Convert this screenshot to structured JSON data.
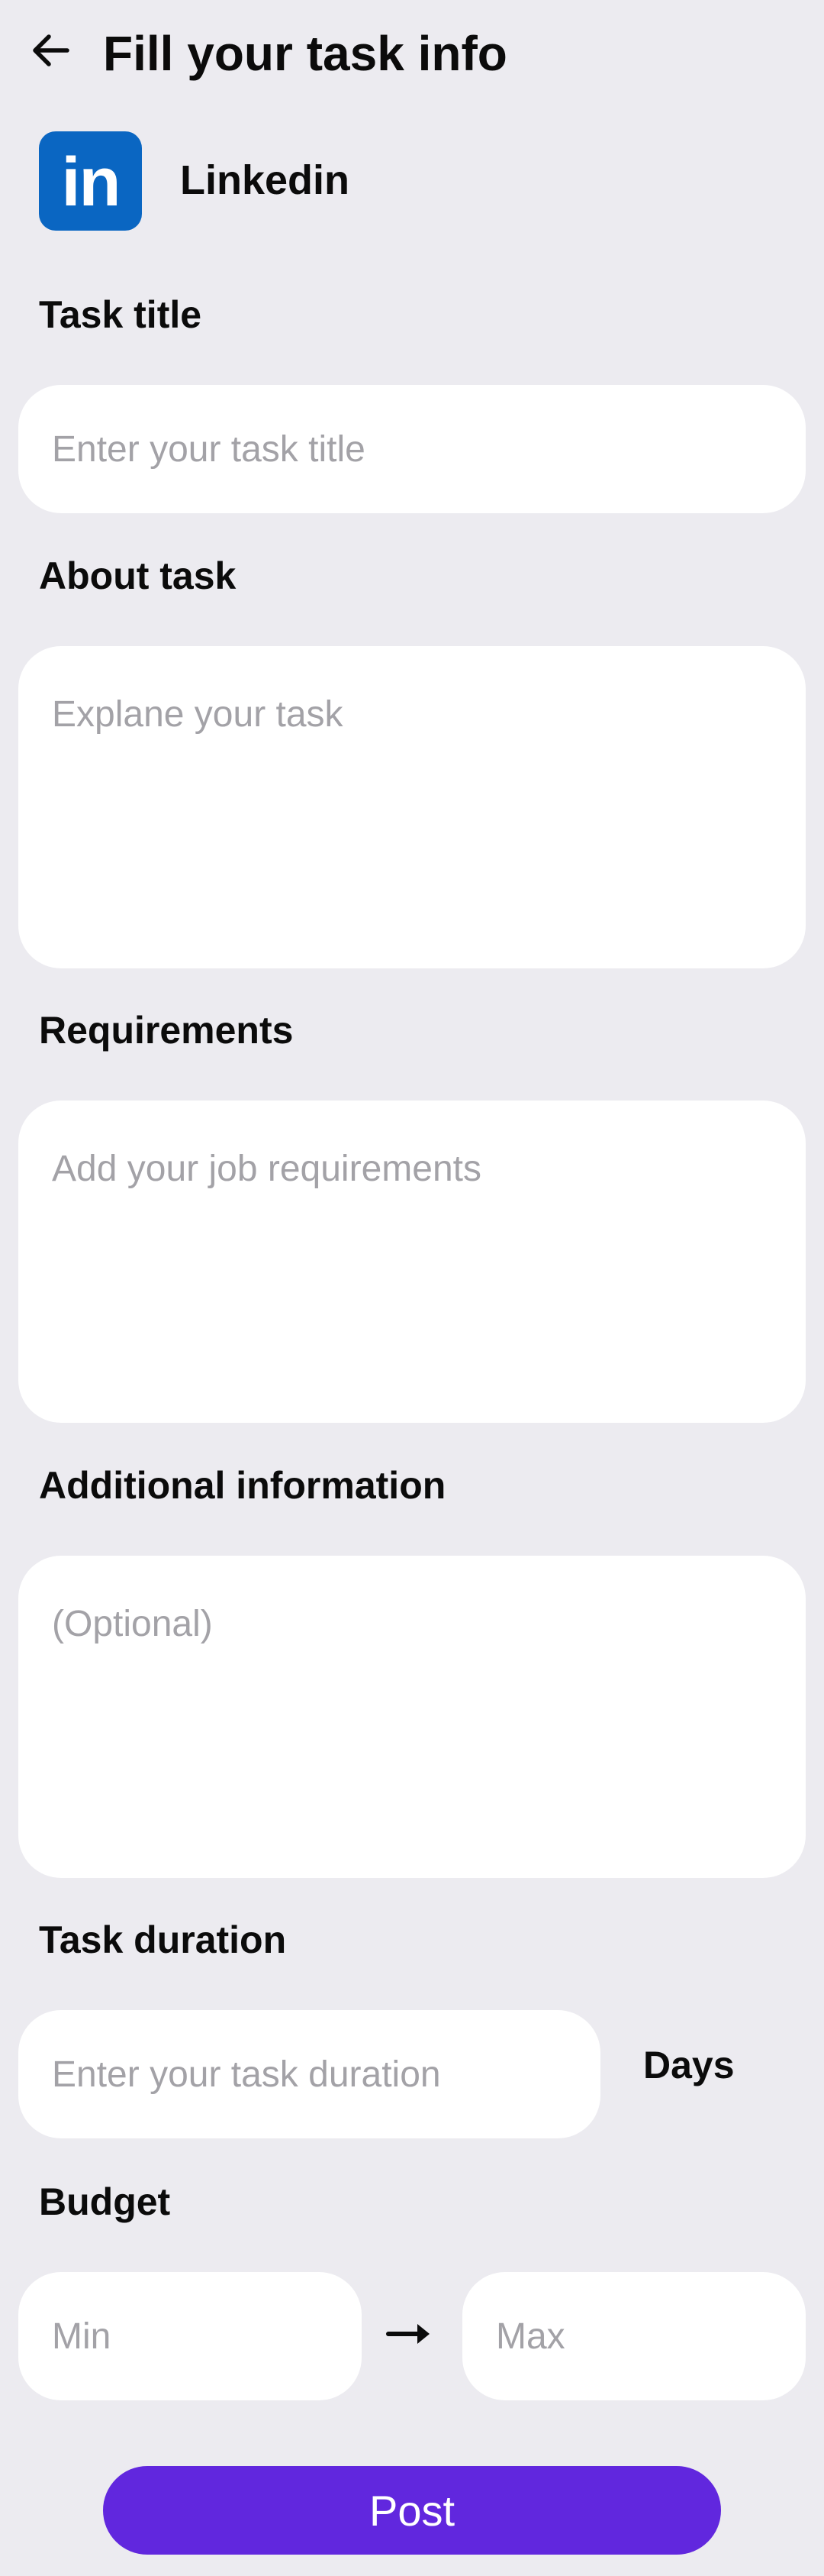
{
  "header": {
    "title": "Fill your task info",
    "back_icon": "arrow-left-icon"
  },
  "company": {
    "logo_text": "in",
    "logo_icon": "linkedin-logo-icon",
    "name": "Linkedin"
  },
  "form": {
    "task_title": {
      "label": "Task title",
      "placeholder": "Enter your task title",
      "value": ""
    },
    "about_task": {
      "label": "About task",
      "placeholder": "Explane your task",
      "value": ""
    },
    "requirements": {
      "label": "Requirements",
      "placeholder": "Add your job requirements",
      "value": ""
    },
    "additional_info": {
      "label": "Additional information",
      "placeholder": "(Optional)",
      "value": ""
    },
    "task_duration": {
      "label": "Task duration",
      "placeholder": "Enter your task duration",
      "value": "",
      "unit": "Days"
    },
    "budget": {
      "label": "Budget",
      "min_placeholder": "Min",
      "max_placeholder": "Max",
      "separator_icon": "arrow-right-icon"
    }
  },
  "post_button": {
    "label": "Post"
  },
  "colors": {
    "background": "#ECEBF0",
    "field": "#FFFFFF",
    "placeholder": "#A3A2A7",
    "text": "#0B0B0B",
    "linkedin_blue": "#0A66C2",
    "accent": "#6127DE"
  }
}
